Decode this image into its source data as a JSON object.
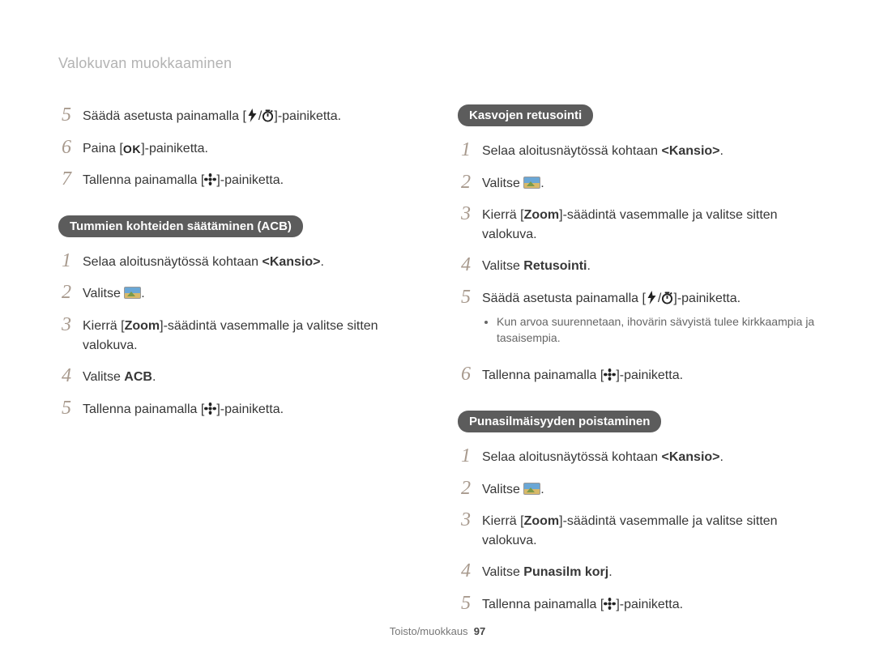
{
  "page_title": "Valokuvan muokkaaminen",
  "footer": {
    "section": "Toisto/muokkaus",
    "page_number": "97"
  },
  "left": {
    "cont_steps": [
      {
        "n": "5",
        "pre": "Säädä asetusta painamalla [",
        "icons": [
          "flash",
          "slash",
          "timer"
        ],
        "post": "]-painiketta."
      },
      {
        "n": "6",
        "pre": "Paina [",
        "icons": [
          "ok"
        ],
        "post": "]-painiketta."
      },
      {
        "n": "7",
        "pre": "Tallenna painamalla [",
        "icons": [
          "flower"
        ],
        "post": "]-painiketta."
      }
    ],
    "section1_title": "Tummien kohteiden säätäminen (ACB)",
    "section1_steps": [
      {
        "n": "1",
        "text_pre": "Selaa aloitusnäytössä kohtaan ",
        "bold_angle": "<Kansio>",
        "text_post": "."
      },
      {
        "n": "2",
        "text_pre": "Valitse ",
        "thumb": true,
        "text_post": "."
      },
      {
        "n": "3",
        "text_pre": "Kierrä [",
        "bold": "Zoom",
        "text_mid": "]-säädintä vasemmalle ja valitse sitten valokuva."
      },
      {
        "n": "4",
        "text_pre": "Valitse ",
        "bold": "ACB",
        "text_post": "."
      },
      {
        "n": "5",
        "pre": "Tallenna painamalla [",
        "icons": [
          "flower"
        ],
        "post": "]-painiketta."
      }
    ]
  },
  "right": {
    "section2_title": "Kasvojen retusointi",
    "section2_steps": [
      {
        "n": "1",
        "text_pre": "Selaa aloitusnäytössä kohtaan ",
        "bold_angle": "<Kansio>",
        "text_post": "."
      },
      {
        "n": "2",
        "text_pre": "Valitse ",
        "thumb": true,
        "text_post": "."
      },
      {
        "n": "3",
        "text_pre": "Kierrä [",
        "bold": "Zoom",
        "text_mid": "]-säädintä vasemmalle ja valitse sitten valokuva."
      },
      {
        "n": "4",
        "text_pre": "Valitse ",
        "bold": "Retusointi",
        "text_post": "."
      },
      {
        "n": "5",
        "pre": "Säädä asetusta painamalla [",
        "icons": [
          "flash",
          "slash",
          "timer"
        ],
        "post": "]-painiketta.",
        "bullets": [
          "Kun arvoa suurennetaan, ihovärin sävyistä tulee kirkkaampia ja tasaisempia."
        ]
      },
      {
        "n": "6",
        "pre": "Tallenna painamalla [",
        "icons": [
          "flower"
        ],
        "post": "]-painiketta."
      }
    ],
    "section3_title": "Punasilmäisyyden poistaminen",
    "section3_steps": [
      {
        "n": "1",
        "text_pre": "Selaa aloitusnäytössä kohtaan ",
        "bold_angle": "<Kansio>",
        "text_post": "."
      },
      {
        "n": "2",
        "text_pre": "Valitse ",
        "thumb": true,
        "text_post": "."
      },
      {
        "n": "3",
        "text_pre": "Kierrä [",
        "bold": "Zoom",
        "text_mid": "]-säädintä vasemmalle ja valitse sitten valokuva."
      },
      {
        "n": "4",
        "text_pre": "Valitse ",
        "bold": "Punasilm korj",
        "text_post": "."
      },
      {
        "n": "5",
        "pre": "Tallenna painamalla [",
        "icons": [
          "flower"
        ],
        "post": "]-painiketta."
      }
    ]
  }
}
